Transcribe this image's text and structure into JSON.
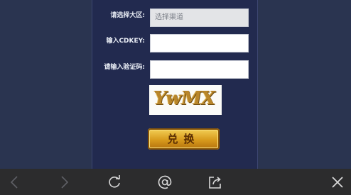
{
  "form": {
    "server_label": "请选择大区:",
    "server_placeholder": "选择渠道",
    "cdkey_label": "输入CDKEY:",
    "cdkey_value": "",
    "captcha_label": "请输入验证码:",
    "captcha_value": "",
    "captcha_image_text": "YwMX",
    "submit_label": "兑换"
  },
  "toolbar": {
    "icons": [
      "back-icon",
      "forward-icon",
      "refresh-icon",
      "at-icon",
      "share-icon",
      "close-icon"
    ],
    "accent": "#2c2c2d"
  },
  "colors": {
    "page_bg": "#2a3450",
    "panel_bg": "#222a4f",
    "button_gold": "#d79a1c"
  }
}
